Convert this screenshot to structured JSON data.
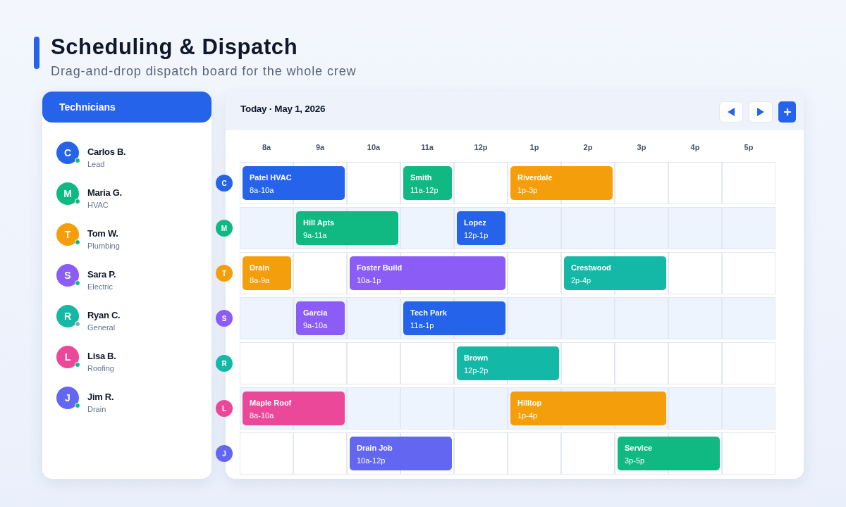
{
  "page": {
    "title": "Scheduling & Dispatch",
    "subtitle": "Drag-and-drop dispatch board for the whole crew"
  },
  "technicians": {
    "title": "Technicians",
    "items": [
      {
        "initial": "C",
        "name": "Carlos B.",
        "role": "Lead",
        "color": "#2563eb",
        "online": true
      },
      {
        "initial": "M",
        "name": "Maria G.",
        "role": "HVAC",
        "color": "#10b981",
        "online": true
      },
      {
        "initial": "T",
        "name": "Tom W.",
        "role": "Plumbing",
        "color": "#f59e0b",
        "online": true
      },
      {
        "initial": "S",
        "name": "Sara P.",
        "role": "Electric",
        "color": "#8b5cf6",
        "online": true
      },
      {
        "initial": "R",
        "name": "Ryan C.",
        "role": "General",
        "color": "#14b8a6",
        "online": false
      },
      {
        "initial": "L",
        "name": "Lisa B.",
        "role": "Roofing",
        "color": "#ec4899",
        "online": true
      },
      {
        "initial": "J",
        "name": "Jim R.",
        "role": "Drain",
        "color": "#6366f1",
        "online": true
      }
    ]
  },
  "board": {
    "date": "Today · May 1, 2026",
    "hours": [
      "8a",
      "9a",
      "10a",
      "11a",
      "12p",
      "1p",
      "2p",
      "3p",
      "4p",
      "5p"
    ],
    "rows": [
      {
        "initial": "C",
        "color": "#2563eb",
        "slots": [
          {
            "kind": "job",
            "title": "Patel HVAC",
            "time": "8a-10a",
            "color": "#2563eb"
          },
          {
            "kind": "cont"
          },
          {
            "kind": "open"
          },
          {
            "kind": "job",
            "title": "Smith",
            "time": "11a-12p",
            "color": "#10b981"
          },
          {
            "kind": "open"
          },
          {
            "kind": "job",
            "title": "Riverdale",
            "time": "1p-3p",
            "color": "#f59e0b"
          },
          {
            "kind": "cont"
          },
          {
            "kind": "open"
          },
          {
            "kind": "open"
          },
          {
            "kind": "open"
          }
        ]
      },
      {
        "initial": "M",
        "color": "#10b981",
        "slots": [
          {
            "kind": "open"
          },
          {
            "kind": "job",
            "title": "Hill Apts",
            "time": "9a-11a",
            "color": "#10b981"
          },
          {
            "kind": "cont"
          },
          {
            "kind": "open"
          },
          {
            "kind": "job",
            "title": "Lopez",
            "time": "12p-1p",
            "color": "#2563eb"
          },
          {
            "kind": "open"
          },
          {
            "kind": "open"
          },
          {
            "kind": "open"
          },
          {
            "kind": "open"
          },
          {
            "kind": "open"
          }
        ]
      },
      {
        "initial": "T",
        "color": "#f59e0b",
        "slots": [
          {
            "kind": "job",
            "title": "Drain",
            "time": "8a-9a",
            "color": "#f59e0b"
          },
          {
            "kind": "open"
          },
          {
            "kind": "job",
            "title": "Foster Build",
            "time": "10a-1p",
            "color": "#8b5cf6"
          },
          {
            "kind": "cont"
          },
          {
            "kind": "cont"
          },
          {
            "kind": "open"
          },
          {
            "kind": "job",
            "title": "Crestwood",
            "time": "2p-4p",
            "color": "#14b8a6"
          },
          {
            "kind": "cont"
          },
          {
            "kind": "open"
          },
          {
            "kind": "open"
          }
        ]
      },
      {
        "initial": "S",
        "color": "#8b5cf6",
        "slots": [
          {
            "kind": "open"
          },
          {
            "kind": "job",
            "title": "Garcia",
            "time": "9a-10a",
            "color": "#8b5cf6"
          },
          {
            "kind": "open"
          },
          {
            "kind": "job",
            "title": "Tech Park",
            "time": "11a-1p",
            "color": "#2563eb"
          },
          {
            "kind": "cont"
          },
          {
            "kind": "open"
          },
          {
            "kind": "open"
          },
          {
            "kind": "open"
          },
          {
            "kind": "open"
          },
          {
            "kind": "open"
          }
        ]
      },
      {
        "initial": "R",
        "color": "#14b8a6",
        "slots": [
          {
            "kind": "open"
          },
          {
            "kind": "open"
          },
          {
            "kind": "open"
          },
          {
            "kind": "open"
          },
          {
            "kind": "job",
            "title": "Brown",
            "time": "12p-2p",
            "color": "#14b8a6"
          },
          {
            "kind": "cont"
          },
          {
            "kind": "open"
          },
          {
            "kind": "open"
          },
          {
            "kind": "open"
          },
          {
            "kind": "open"
          }
        ]
      },
      {
        "initial": "L",
        "color": "#ec4899",
        "slots": [
          {
            "kind": "job",
            "title": "Maple Roof",
            "time": "8a-10a",
            "color": "#ec4899"
          },
          {
            "kind": "cont"
          },
          {
            "kind": "open"
          },
          {
            "kind": "open"
          },
          {
            "kind": "open"
          },
          {
            "kind": "job",
            "title": "Hilltop",
            "time": "1p-4p",
            "color": "#f59e0b"
          },
          {
            "kind": "cont"
          },
          {
            "kind": "cont"
          },
          {
            "kind": "open"
          },
          {
            "kind": "open"
          }
        ]
      },
      {
        "initial": "J",
        "color": "#6366f1",
        "slots": [
          {
            "kind": "open"
          },
          {
            "kind": "open"
          },
          {
            "kind": "job",
            "title": "Drain Job",
            "time": "10a-12p",
            "color": "#6366f1"
          },
          {
            "kind": "cont"
          },
          {
            "kind": "open"
          },
          {
            "kind": "open"
          },
          {
            "kind": "open"
          },
          {
            "kind": "job",
            "title": "Service",
            "time": "3p-5p",
            "color": "#10b981"
          },
          {
            "kind": "cont"
          },
          {
            "kind": "open"
          }
        ]
      }
    ]
  }
}
